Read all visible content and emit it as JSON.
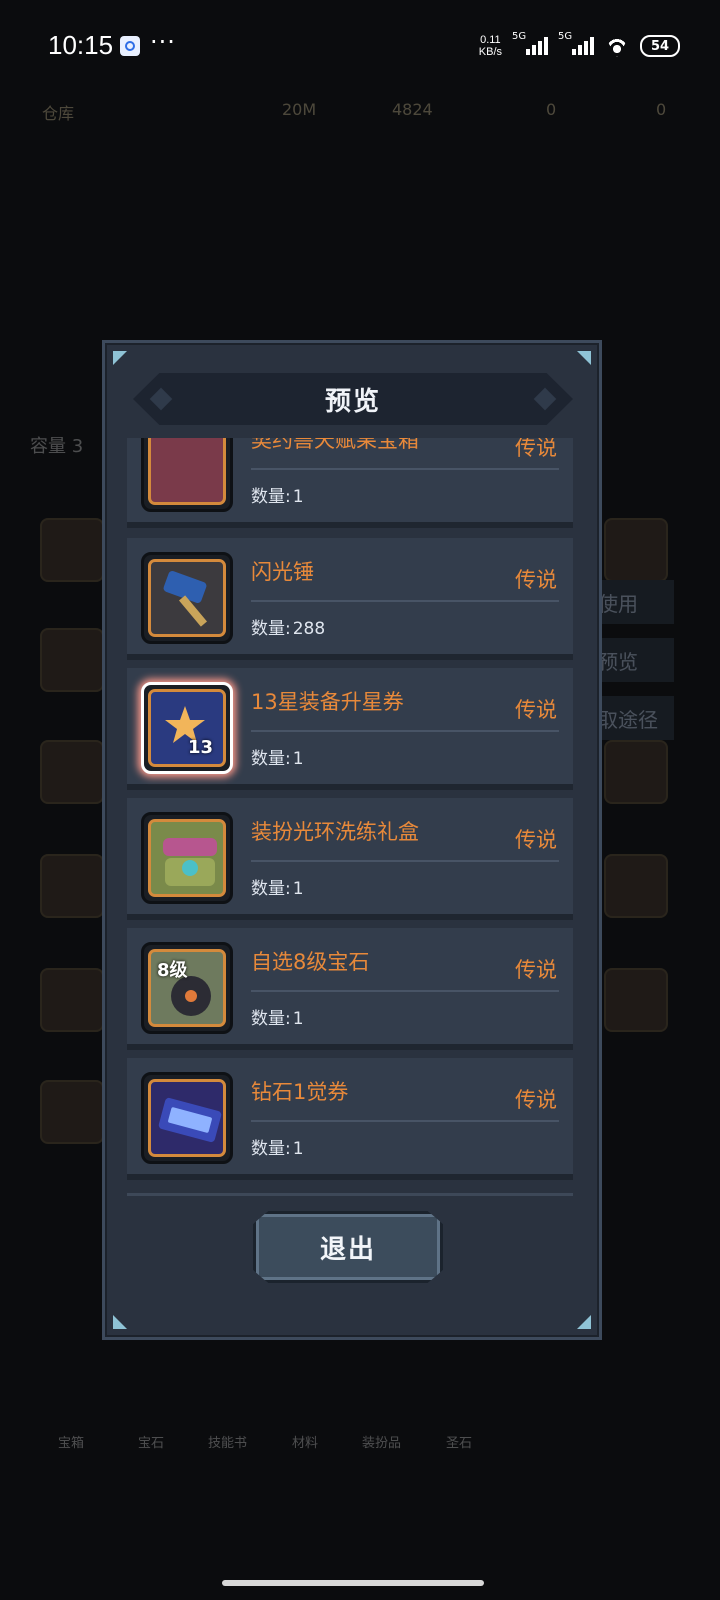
{
  "status_bar": {
    "time": "10:15",
    "menu_dots": "···",
    "net_speed_value": "0.11",
    "net_speed_unit": "KB/s",
    "signal1_label": "5G",
    "signal2_label": "5G",
    "battery": "54"
  },
  "background": {
    "title": "仓库",
    "res1": "20M",
    "res2": "4824",
    "res3": "0",
    "res4": "0",
    "capacity_label": "容量 3",
    "side_buttons": [
      "使用",
      "预览",
      "取途径"
    ],
    "bottom_tabs": [
      "宝箱",
      "宝石",
      "技能书",
      "材料",
      "装扮品",
      "圣石"
    ]
  },
  "modal": {
    "title": "预览",
    "quantity_label": "数量:",
    "items": [
      {
        "name": "契约兽天赋果宝箱",
        "rarity": "传说",
        "quantity": "1"
      },
      {
        "name": "闪光锤",
        "rarity": "传说",
        "quantity": "288"
      },
      {
        "name": "13星装备升星券",
        "rarity": "传说",
        "quantity": "1",
        "icon_badge": "13"
      },
      {
        "name": "装扮光环洗练礼盒",
        "rarity": "传说",
        "quantity": "1"
      },
      {
        "name": "自选8级宝石",
        "rarity": "传说",
        "quantity": "1",
        "icon_badge": "8级"
      },
      {
        "name": "钻石1觉券",
        "rarity": "传说",
        "quantity": "1"
      }
    ],
    "exit_button": "退出"
  },
  "colors": {
    "rarity_legendary": "#e8893a",
    "modal_bg": "#2a323f",
    "item_bg": "#333d4c"
  }
}
